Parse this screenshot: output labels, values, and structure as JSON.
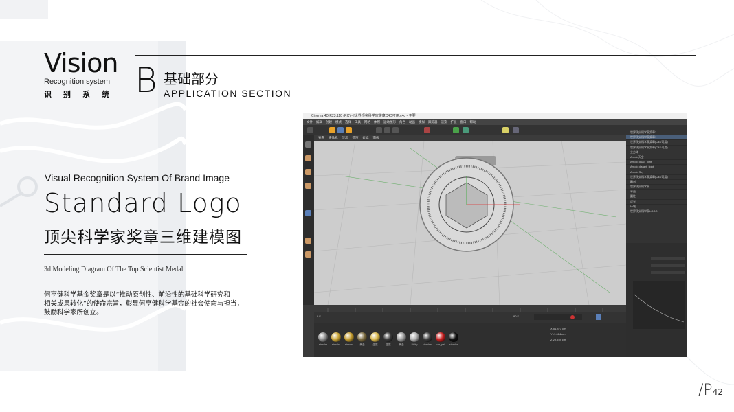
{
  "header": {
    "vision_title": "Vision",
    "vision_sub": "Recognition system",
    "vision_cn": "识别系统",
    "section_letter": "B",
    "section_cn": "基础部分",
    "section_en": "APPLICATION SECTION"
  },
  "content": {
    "brand_caption": "Visual Recognition System Of Brand Image",
    "title": "Standard  Logo",
    "cn_heading": "顶尖科学家奖章三维建模图",
    "en_sub": "3d Modeling Diagram Of The Top Scientist Medal",
    "desc_line1": "何亨健科学基金奖章是以“推动原创性、前沿性的基础科学研究和",
    "desc_line2": "相关成果转化”的使命宗旨，彰显何亨健科学基金的社会使命与担当，",
    "desc_line3": "鼓励科学家所创立。"
  },
  "page": {
    "slash": "/",
    "prefix": "P",
    "number": "42"
  },
  "screenshot": {
    "window_title": "Cinema 4D R23.110 (RC) - [世界顶尖科学家奖章C4D可用.c4d - 主要]",
    "menu": [
      "文件",
      "编辑",
      "创建",
      "模式",
      "选择",
      "工具",
      "网格",
      "体积",
      "运动图形",
      "角色",
      "动画",
      "模拟",
      "跟踪器",
      "渲染",
      "扩展",
      "窗口",
      "帮助"
    ],
    "viewport_menu": [
      "查看",
      "摄像机",
      "显示",
      "选项",
      "过滤",
      "面板"
    ],
    "objects": [
      "世界顶尖科学家奖章2",
      "世界顶尖科学家奖章1",
      "世界顶尖科学家奖章(C4D可用)",
      "世界顶尖科学家奖章(C4D可用)",
      "立方体",
      "Arnold天空",
      "Arnold quad_light",
      "Arnold distant_light",
      "Arnold Sky",
      "世界顶尖科学家奖章(C4D可用)",
      "雕刻",
      "世界顶尖科学家",
      "平面",
      "圆柱",
      "灯光",
      "环境",
      "世界顶尖科学家LOGO"
    ],
    "materials": [
      "standar",
      "standar",
      "standar",
      "黄金",
      "金属",
      "金属",
      "黄金",
      "Utility",
      "standard",
      "car_pai",
      "standar"
    ],
    "material_colors": [
      "#8c8c8c",
      "#c9a436",
      "#c29a2c",
      "#7a6a40",
      "#d7b54a",
      "#3a3a3a",
      "#9a9a9a",
      "#b0b0b0",
      "#3b3b3b",
      "#c82020",
      "#111111"
    ],
    "coord_labels": [
      "X",
      "Y",
      "Z"
    ],
    "coord_values": [
      "51.873 cm",
      "-1.664 cm",
      "29.939 cm"
    ],
    "frame_start": "0 F",
    "frame_end": "90 F"
  }
}
